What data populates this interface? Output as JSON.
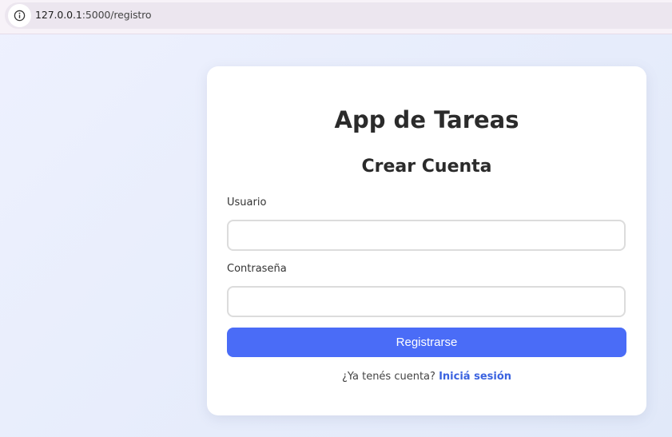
{
  "browser": {
    "url_host": "127.0.0.1",
    "url_rest": ":5000/registro",
    "info_icon": "info-icon"
  },
  "card": {
    "app_title": "App de Tareas",
    "form_title": "Crear Cuenta",
    "username_label": "Usuario",
    "username_value": "",
    "password_label": "Contraseña",
    "password_value": "",
    "submit_label": "Registrarse",
    "login_prompt": "¿Ya tenés cuenta?",
    "login_link": "Iniciá sesión"
  },
  "colors": {
    "accent": "#4a6cf7",
    "link": "#3b63e0",
    "card_bg": "#ffffff"
  }
}
